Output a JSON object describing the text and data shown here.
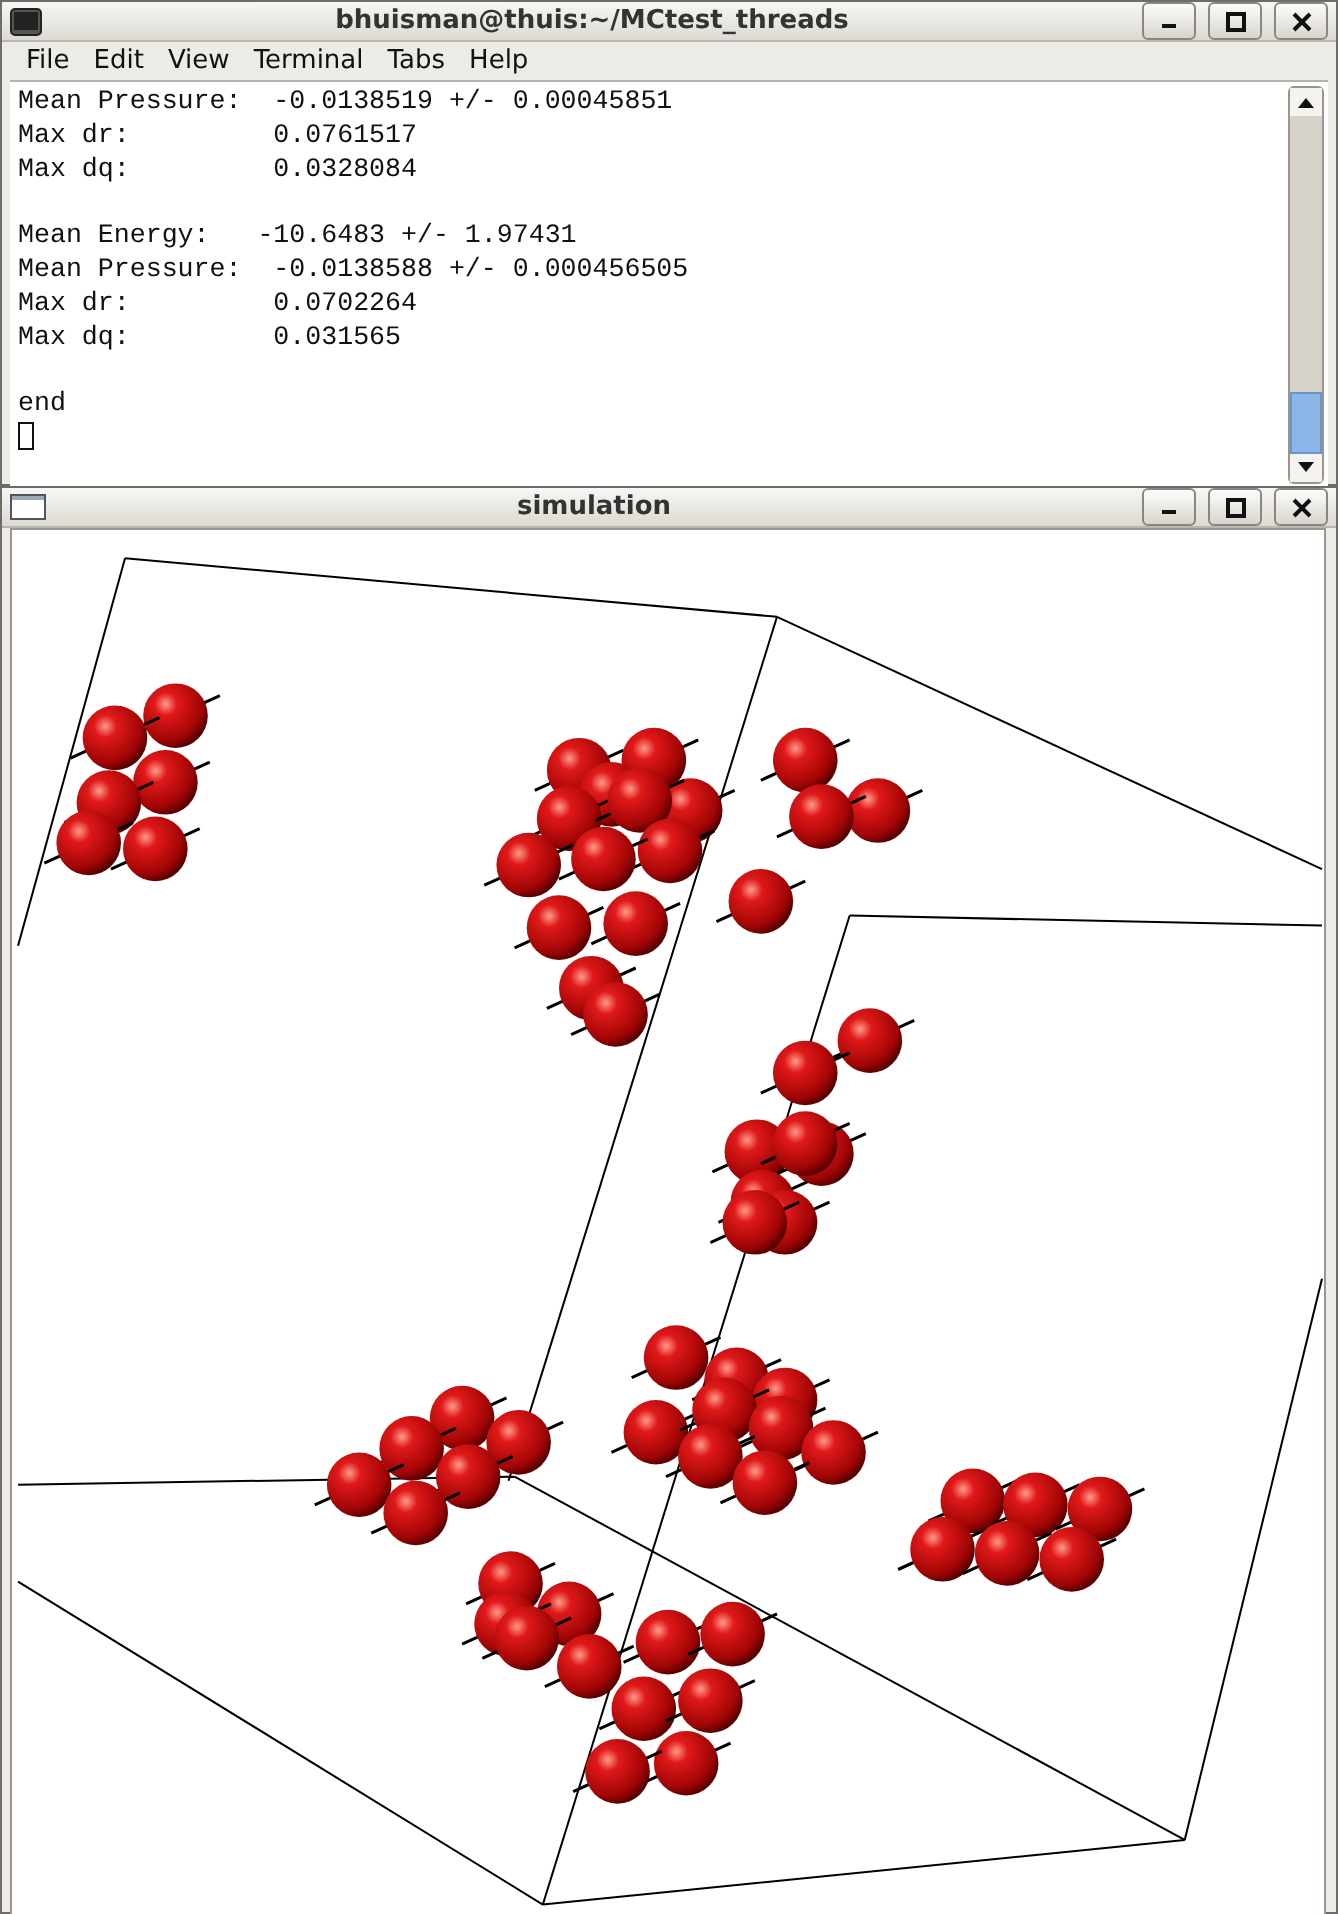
{
  "terminal_window": {
    "title": "bhuisman@thuis:~/MCtest_threads",
    "menu": [
      "File",
      "Edit",
      "View",
      "Terminal",
      "Tabs",
      "Help"
    ],
    "output_blocks": [
      [
        "Mean Pressure:  -0.0138519 +/- 0.00045851",
        "Max dr:         0.0761517",
        "Max dq:         0.0328084"
      ],
      [
        "Mean Energy:   -10.6483 +/- 1.97431",
        "Mean Pressure:  -0.0138588 +/- 0.000456505",
        "Max dr:         0.0702264",
        "Max dq:         0.031565"
      ],
      [
        "end"
      ]
    ]
  },
  "simulation_window": {
    "title": "simulation"
  }
}
